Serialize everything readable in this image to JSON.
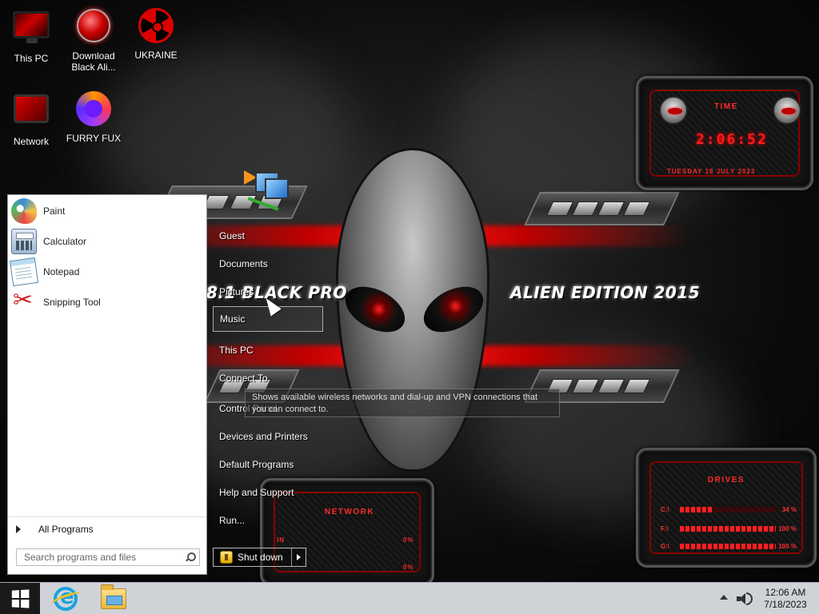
{
  "desktop": {
    "icons": [
      {
        "label": "This PC",
        "icon": "this-pc-icon"
      },
      {
        "label": "Download Black Ali...",
        "icon": "alien-globe-icon"
      },
      {
        "label": "UKRAINE",
        "icon": "radiation-icon"
      },
      {
        "label": "Network",
        "icon": "network-icon"
      },
      {
        "label": "FURRY FUX",
        "icon": "firefox-icon"
      }
    ]
  },
  "wallpaper": {
    "title_left": "8.1 BLACK PRO",
    "title_right": "ALIEN EDITION 2015",
    "accent_color": "#ff1a1a"
  },
  "gadgets": {
    "time": {
      "title": "TIME",
      "clock": "2:06:52",
      "date": "TUESDAY 18 JULY 2023"
    },
    "network": {
      "title": "NETWORK",
      "in_label": "IN",
      "in_value": "0%",
      "out_value": "0%"
    },
    "drives": {
      "title": "DRIVES",
      "items": [
        {
          "label": "C:\\",
          "percent": "34 %",
          "fill": 0.34
        },
        {
          "label": "F:\\",
          "percent": "100 %",
          "fill": 1.0
        },
        {
          "label": "G:\\",
          "percent": "100 %",
          "fill": 1.0
        }
      ]
    }
  },
  "start_menu": {
    "programs": [
      {
        "label": "Paint",
        "icon": "paint-icon"
      },
      {
        "label": "Calculator",
        "icon": "calculator-icon"
      },
      {
        "label": "Notepad",
        "icon": "notepad-icon"
      },
      {
        "label": "Snipping Tool",
        "icon": "snipping-tool-icon"
      }
    ],
    "all_programs": "All Programs",
    "search_placeholder": "Search programs and files",
    "right_items": [
      "Guest",
      "Documents",
      "Pictures",
      "Music",
      "This PC",
      "Connect To",
      "Control Panel",
      "Devices and Printers",
      "Default Programs",
      "Help and Support",
      "Run..."
    ],
    "highlighted_item": "Music",
    "tooltip": "Shows available wireless networks and dial-up and VPN connections that you can connect to.",
    "shutdown_label": "Shut down"
  },
  "taskbar": {
    "pinned": [
      "internet-explorer-icon",
      "file-explorer-icon"
    ],
    "clock_time": "12:06 AM",
    "clock_date": "7/18/2023"
  }
}
